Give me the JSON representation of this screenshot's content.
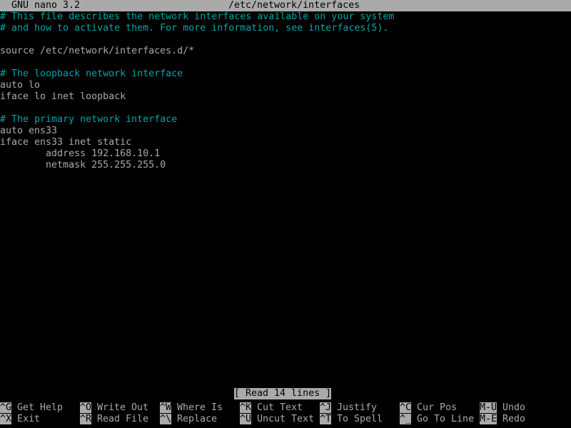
{
  "titlebar": {
    "app": "GNU nano 3.2",
    "filename": "/etc/network/interfaces",
    "app_col": 2,
    "filename_col": 40,
    "bg": "#aaaaaa",
    "fg": "#000000"
  },
  "colors": {
    "background": "#000000",
    "foreground": "#aaaaaa",
    "comment": "#00a6a6",
    "inverse_bg": "#aaaaaa",
    "inverse_fg": "#000000"
  },
  "editor": {
    "lines": [
      {
        "text": "# This file describes the network interfaces available on your system",
        "kind": "comment"
      },
      {
        "text": "# and how to activate them. For more information, see interfaces(5).",
        "kind": "comment"
      },
      {
        "text": "",
        "kind": "text"
      },
      {
        "text": "source /etc/network/interfaces.d/*",
        "kind": "text"
      },
      {
        "text": "",
        "kind": "text"
      },
      {
        "text": "# The loopback network interface",
        "kind": "comment"
      },
      {
        "text": "auto lo",
        "kind": "text"
      },
      {
        "text": "iface lo inet loopback",
        "kind": "text"
      },
      {
        "text": "",
        "kind": "text"
      },
      {
        "text": "# The primary network interface",
        "kind": "comment"
      },
      {
        "text": "auto ens33",
        "kind": "text"
      },
      {
        "text": "iface ens33 inet static",
        "kind": "text"
      },
      {
        "text": "        address 192.168.10.1",
        "kind": "text"
      },
      {
        "text": "        netmask 255.255.255.0",
        "kind": "text"
      }
    ]
  },
  "status": {
    "message": "[ Read 14 lines ]",
    "col": 41
  },
  "shortcuts": [
    {
      "key": "^G",
      "label": "Get Help",
      "row": 0,
      "col": 0
    },
    {
      "key": "^X",
      "label": "Exit",
      "row": 1,
      "col": 0
    },
    {
      "key": "^O",
      "label": "Write Out",
      "row": 0,
      "col": 14
    },
    {
      "key": "^R",
      "label": "Read File",
      "row": 1,
      "col": 14
    },
    {
      "key": "^W",
      "label": "Where Is",
      "row": 0,
      "col": 28
    },
    {
      "key": "^\\",
      "label": "Replace",
      "row": 1,
      "col": 28
    },
    {
      "key": "^K",
      "label": "Cut Text",
      "row": 0,
      "col": 42
    },
    {
      "key": "^U",
      "label": "Uncut Text",
      "row": 1,
      "col": 42
    },
    {
      "key": "^J",
      "label": "Justify",
      "row": 0,
      "col": 56
    },
    {
      "key": "^T",
      "label": "To Spell",
      "row": 1,
      "col": 56
    },
    {
      "key": "^C",
      "label": "Cur Pos",
      "row": 0,
      "col": 70
    },
    {
      "key": "^_",
      "label": "Go To Line",
      "row": 1,
      "col": 70
    },
    {
      "key": "M-U",
      "label": "Undo",
      "row": 0,
      "col": 84
    },
    {
      "key": "M-E",
      "label": "Redo",
      "row": 1,
      "col": 84
    }
  ]
}
